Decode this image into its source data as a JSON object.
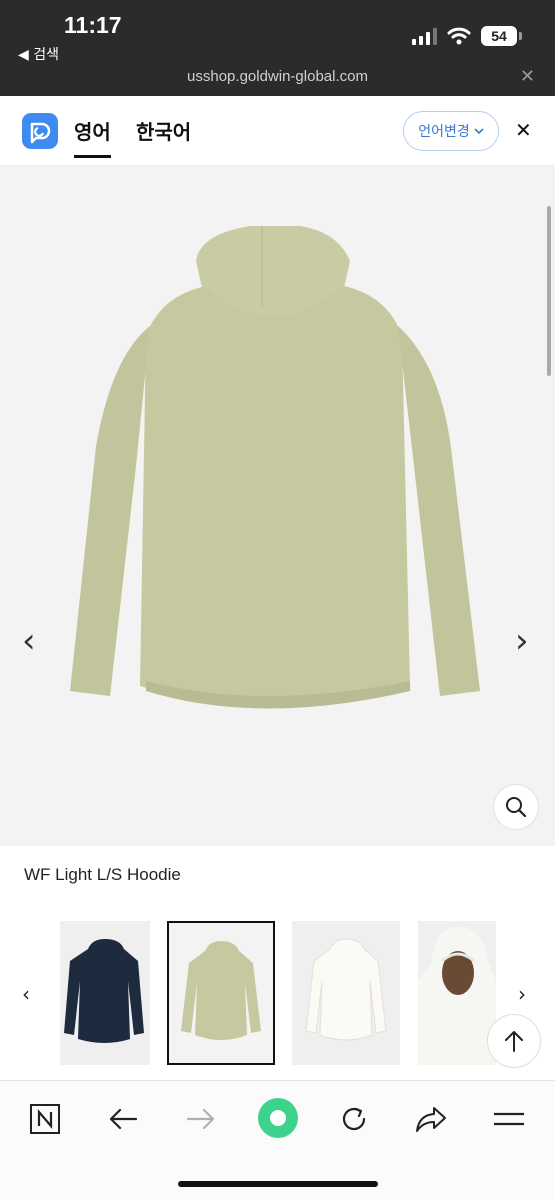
{
  "status": {
    "time": "11:17",
    "back_label": "◀ 검색",
    "battery": "54"
  },
  "browser": {
    "url": "usshop.goldwin-global.com",
    "close": "✕"
  },
  "translate": {
    "tab_active": "영어",
    "tab_other": "한국어",
    "lang_change": "언어변경",
    "close": "✕"
  },
  "product": {
    "name": "WF Light L/S Hoodie",
    "prev_arrow": "‹",
    "next_arrow": "›",
    "main_color": "#c6c9a0",
    "thumbnails": [
      {
        "color": "#1e2a3e",
        "icon": "navy-hoodie"
      },
      {
        "color": "#c6c9a0",
        "icon": "sage-hoodie",
        "selected": true
      },
      {
        "color": "#f4f3ee",
        "icon": "white-hoodie"
      },
      {
        "color": "#f2f2ef",
        "icon": "model-wearing-hood"
      }
    ],
    "thumb_prev": "‹",
    "thumb_next": "›"
  },
  "toolbar": {
    "icons": [
      "naver-n-icon",
      "back-arrow-icon",
      "forward-arrow-icon",
      "green-record-icon",
      "refresh-icon",
      "share-icon",
      "menu-icon"
    ]
  }
}
